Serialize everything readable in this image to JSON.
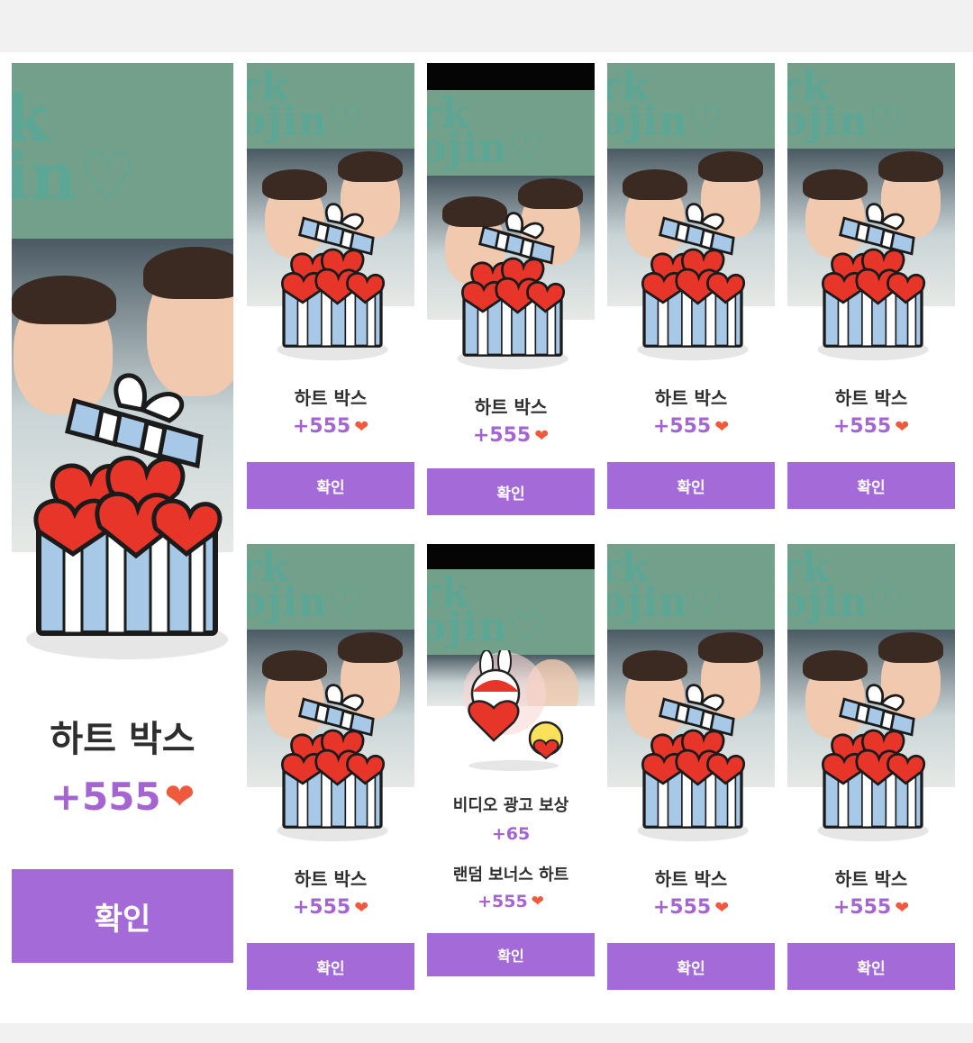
{
  "banner_text": "ark\nojin",
  "cards": {
    "c0": {
      "title": "하트 박스",
      "amount": "+555",
      "button": "확인"
    },
    "c1": {
      "title": "하트 박스",
      "amount": "+555",
      "button": "확인"
    },
    "c2": {
      "title": "하트 박스",
      "amount": "+555",
      "button": "확인"
    },
    "c3": {
      "title": "하트 박스",
      "amount": "+555",
      "button": "확인"
    },
    "c4": {
      "title": "하트 박스",
      "amount": "+555",
      "button": "확인"
    },
    "c5": {
      "title": "하트 박스",
      "amount": "+555",
      "button": "확인"
    },
    "c6": {
      "title": "비디오 광고 보상",
      "amount": "+65",
      "title2": "랜덤 보너스 하트",
      "amount2": "+555",
      "button": "확인"
    },
    "c7": {
      "title": "하트 박스",
      "amount": "+555",
      "button": "확인"
    },
    "c8": {
      "title": "하트 박스",
      "amount": "+555",
      "button": "확인"
    }
  },
  "icons": {
    "gift": "gift-box-hearts-icon",
    "heart": "heart-icon",
    "mascot": "bunny-duck-mascot-icon"
  },
  "colors": {
    "accent": "#a46bd8",
    "amount": "#a465d3",
    "heart": "#ef5a3d",
    "banner": "#72a08a"
  }
}
